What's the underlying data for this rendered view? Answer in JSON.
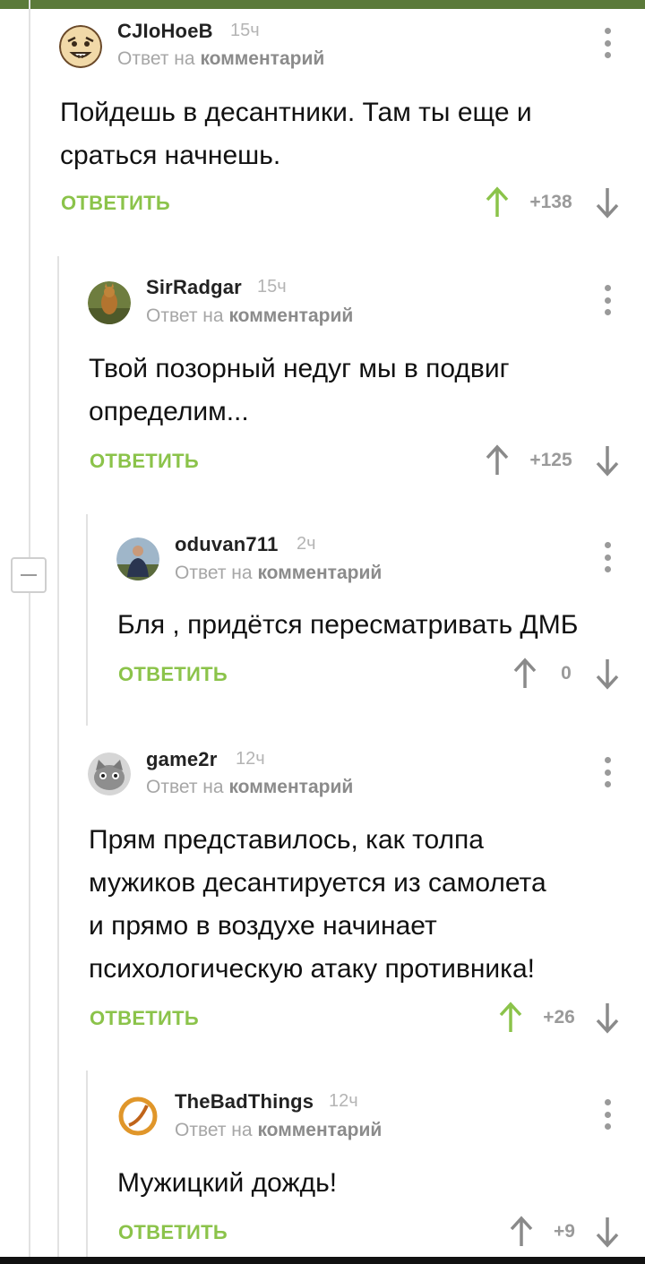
{
  "colors": {
    "accent": "#8bc34a",
    "upvoted": "#8bc34a",
    "neutral": "#9a9a9a",
    "topbar": "#5b7a3a"
  },
  "reply_to_prefix": "Ответ на",
  "reply_to_target": "комментарий",
  "reply_label": "ОТВЕТИТЬ",
  "comments": [
    {
      "author": "CJIoHoeB",
      "time": "15ч",
      "text_lines": [
        "Пойдешь в десантники. Там ты еще и",
        "сраться начнешь."
      ],
      "score": "+138",
      "upvoted": true,
      "avatar_icon": "cartoon-face-avatar"
    },
    {
      "author": "SirRadgar",
      "time": "15ч",
      "text_lines": [
        "Твой позорный недуг мы в подвиг",
        "определим..."
      ],
      "score": "+125",
      "upvoted": false,
      "avatar_icon": "animal-photo-avatar"
    },
    {
      "author": "oduvan711",
      "time": "2ч",
      "text_lines": [
        "Бля , придётся пересматривать ДМБ"
      ],
      "score": "0",
      "upvoted": false,
      "avatar_icon": "person-photo-avatar"
    },
    {
      "author": "game2r",
      "time": "12ч",
      "text_lines": [
        "Прям представилось, как толпа",
        "мужиков десантируется из самолета",
        "и прямо в воздухе начинает",
        "психологическую атаку противника!"
      ],
      "score": "+26",
      "upvoted": true,
      "avatar_icon": "cat-photo-avatar"
    },
    {
      "author": "TheBadThings",
      "time": "12ч",
      "text_lines": [
        "Мужицкий дождь!"
      ],
      "score": "+9",
      "upvoted": false,
      "avatar_icon": "orange-ring-avatar"
    }
  ]
}
